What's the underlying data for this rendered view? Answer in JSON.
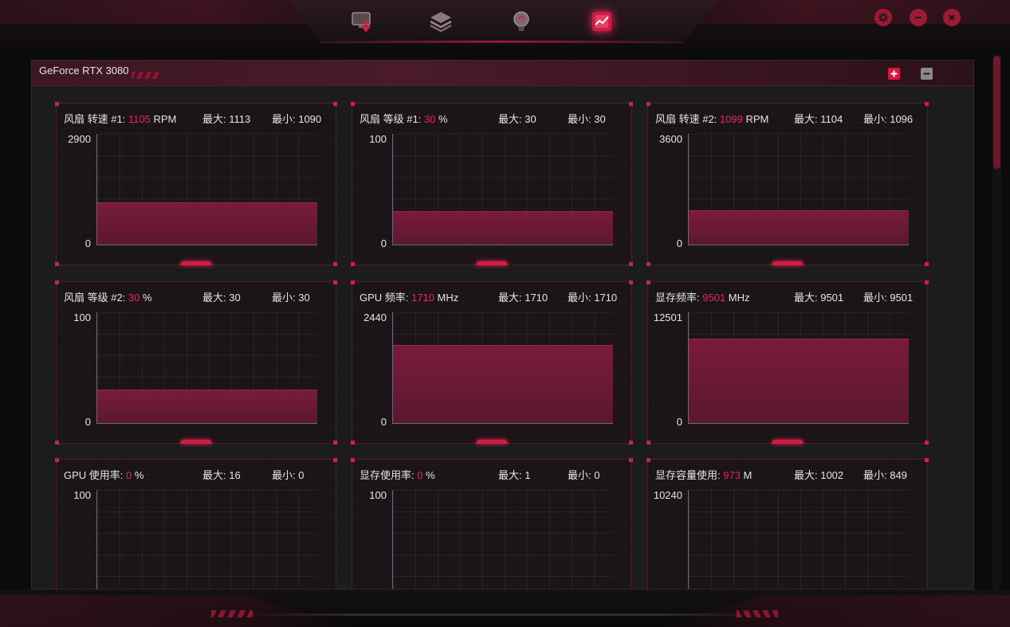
{
  "app": {
    "nav": [
      {
        "icon": "monitor-download-icon",
        "active": false
      },
      {
        "icon": "layers-icon",
        "active": false
      },
      {
        "icon": "lightbulb-icon",
        "active": false
      },
      {
        "icon": "performance-monitor-icon",
        "active": true
      }
    ],
    "window_controls": [
      "settings-icon",
      "minimize-icon",
      "close-icon"
    ]
  },
  "panel": {
    "title": "GeForce RTX 3080"
  },
  "colors": {
    "accent": "#ee2456",
    "chart_fill": "#6e1a38",
    "panel_bg": "#1c1b1e"
  },
  "cards": [
    {
      "label": "风扇 转速 #1: ",
      "value": "1105",
      "unit": " RPM",
      "max": "最大: 1113",
      "min": "最小: 1090",
      "y_top": "2900",
      "y_zero": "0",
      "current": 1105,
      "scale_max": 2900
    },
    {
      "label": "风扇 等级 #1: ",
      "value": "30",
      "unit": " %",
      "max": "最大: 30",
      "min": "最小: 30",
      "y_top": "100",
      "y_zero": "0",
      "current": 30,
      "scale_max": 100
    },
    {
      "label": "风扇 转速 #2: ",
      "value": "1099",
      "unit": " RPM",
      "max": "最大: 1104",
      "min": "最小: 1096",
      "y_top": "3600",
      "y_zero": "0",
      "current": 1099,
      "scale_max": 3600
    },
    {
      "label": "风扇 等级 #2: ",
      "value": "30",
      "unit": " %",
      "max": "最大: 30",
      "min": "最小: 30",
      "y_top": "100",
      "y_zero": "0",
      "current": 30,
      "scale_max": 100
    },
    {
      "label": "GPU 频率: ",
      "value": "1710",
      "unit": " MHz",
      "max": "最大: 1710",
      "min": "最小: 1710",
      "y_top": "2440",
      "y_zero": "0",
      "current": 1710,
      "scale_max": 2440
    },
    {
      "label": "显存频率: ",
      "value": "9501",
      "unit": " MHz",
      "max": "最大: 9501",
      "min": "最小: 9501",
      "y_top": "12501",
      "y_zero": "0",
      "current": 9501,
      "scale_max": 12501
    },
    {
      "label": "GPU 使用率: ",
      "value": "0",
      "unit": " %",
      "max": "最大: 16",
      "min": "最小: 0",
      "y_top": "100",
      "y_zero": "",
      "current": 0,
      "scale_max": 100
    },
    {
      "label": "显存使用率: ",
      "value": "0",
      "unit": " %",
      "max": "最大: 1",
      "min": "最小: 0",
      "y_top": "100",
      "y_zero": "",
      "current": 0,
      "scale_max": 100
    },
    {
      "label": "显存容量使用: ",
      "value": "973",
      "unit": " M",
      "max": "最大: 1002",
      "min": "最小: 849",
      "y_top": "10240",
      "y_zero": "",
      "current": 973,
      "scale_max": 10240
    }
  ]
}
